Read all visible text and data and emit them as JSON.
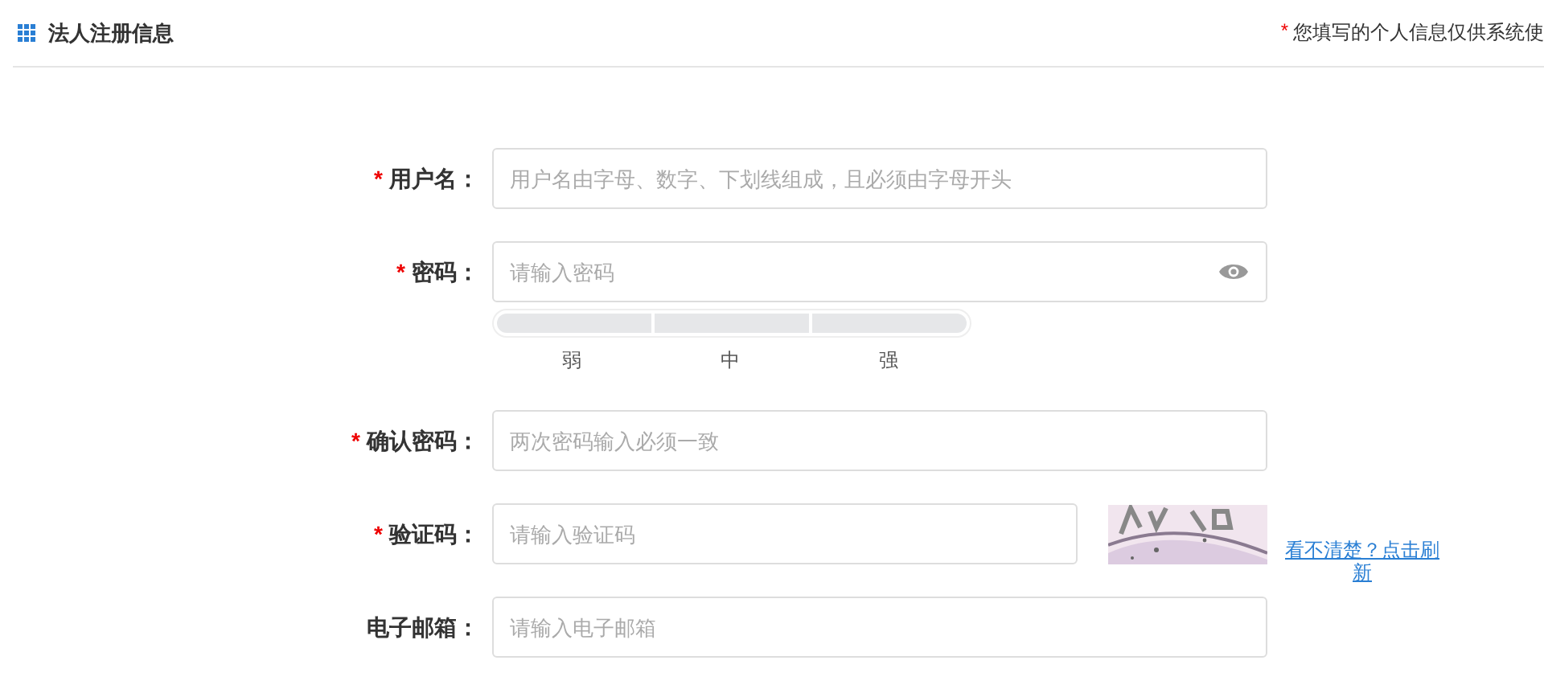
{
  "header": {
    "title": "法人注册信息",
    "notice": {
      "mark": "*",
      "text": "您填写的个人信息仅供系统使"
    }
  },
  "fields": [
    {
      "kind": "text",
      "label": "用户名：",
      "required": true,
      "placeholder": "用户名由字母、数字、下划线组成，且必须由字母开头"
    },
    {
      "kind": "password",
      "label": "密码：",
      "required": true,
      "placeholder": "请输入密码",
      "strength": [
        {
          "label": "弱",
          "on": false
        },
        {
          "label": "中",
          "on": false
        },
        {
          "label": "强",
          "on": false
        }
      ]
    },
    {
      "kind": "text",
      "label": "确认密码：",
      "required": true,
      "placeholder": "两次密码输入必须一致"
    },
    {
      "kind": "captcha",
      "label": "验证码：",
      "required": true,
      "placeholder": "请输入验证码",
      "link": "看不清楚？点击刷新"
    },
    {
      "kind": "text",
      "label": "电子邮箱：",
      "required": false,
      "placeholder": "请输入电子邮箱"
    }
  ]
}
